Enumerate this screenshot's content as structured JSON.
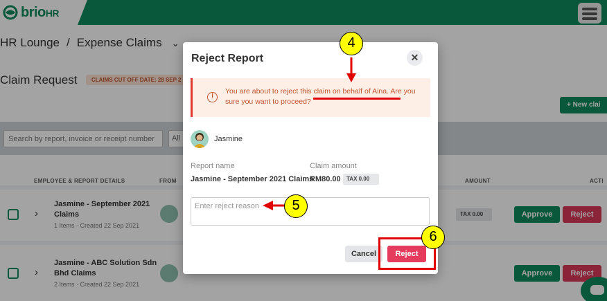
{
  "app": {
    "logo_text": "brio",
    "logo_suffix": "HR"
  },
  "breadcrumb": {
    "parent": "HR Lounge",
    "separator": "/",
    "current": "Expense Claims"
  },
  "page": {
    "title": "Claim Request",
    "cutoff_badge": "CLAIMS CUT OFF DATE: 28 SEP 2",
    "new_claim_label": "+ New clai"
  },
  "filters": {
    "search_placeholder": "Search by report, invoice or receipt number",
    "status_select": "All"
  },
  "table": {
    "headers": {
      "employee": "EMPLOYEE & REPORT DETAILS",
      "from": "FROM",
      "amount": "AMOUNT",
      "action": "ACTI"
    },
    "rows": [
      {
        "title": "Jasmine - September 2021 Claims",
        "meta": "1 Items · Created 22 Sep 2021",
        "tax": "TAX 0.00",
        "approve": "Approve",
        "reject": "Reject"
      },
      {
        "title": "Jasmine - ABC Solution Sdn Bhd Claims",
        "meta": "2 Items · Created 22 Sep 2021",
        "tax": "",
        "approve": "Approve",
        "reject": "Reject"
      }
    ]
  },
  "modal": {
    "title": "Reject Report",
    "close_glyph": "✕",
    "alert": {
      "icon_glyph": "!",
      "text": "You are about to reject this claim on behalf of Aina. Are you sure you want to proceed?"
    },
    "employee_name": "Jasmine",
    "report_name_label": "Report name",
    "report_name_value": "Jasmine - September 2021 Claims",
    "claim_amount_label": "Claim amount",
    "claim_amount_value": "RM80.00",
    "tax": "TAX 0.00",
    "reason_placeholder": "Enter reject reason",
    "cancel_label": "Cancel",
    "reject_label": "Reject"
  },
  "annotations": {
    "step_4": "4",
    "step_5": "5",
    "step_6": "6",
    "highlight_color": "#e00000",
    "marker_color": "#ffff00"
  },
  "colors": {
    "brand_green": "#0f8a5f",
    "reject_red": "#e53b5c",
    "alert_bg": "#fdeee6",
    "alert_text": "#c0552f"
  }
}
